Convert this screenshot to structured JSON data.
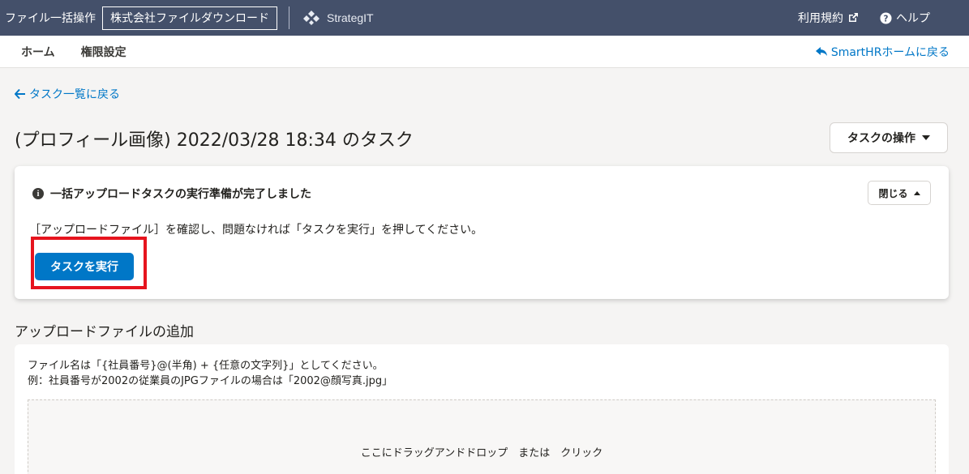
{
  "header": {
    "app_title": "ファイル一括操作",
    "company_name": "株式会社ファイルダウンロード",
    "logo_text": "StrategIT",
    "terms_label": "利用規約",
    "help_label": "ヘルプ"
  },
  "subnav": {
    "items": [
      "ホーム",
      "権限設定"
    ],
    "back_smarthr": "SmartHRホームに戻る"
  },
  "back_to_list": "タスク一覧に戻る",
  "page": {
    "title": "(プロフィール画像) 2022/03/28 18:34 のタスク",
    "task_ops_label": "タスクの操作"
  },
  "notice": {
    "heading": "一括アップロードタスクの実行準備が完了しました",
    "close_label": "閉じる",
    "body": "［アップロードファイル］を確認し、問題なければ「タスクを実行」を押してください。",
    "run_button": "タスクを実行"
  },
  "upload": {
    "section_title": "アップロードファイルの追加",
    "desc_line1": "ファイル名は「{社員番号}@(半角) + {任意の文字列}」としてください。",
    "desc_line2": "例：社員番号が2002の従業員のJPGファイルの場合は「2002@顔写真.jpg」",
    "dropzone_text": "ここにドラッグアンドドロップ　または　クリック"
  },
  "colors": {
    "header_bg": "#44506a",
    "link": "#0077c7",
    "primary_button": "#0077c7",
    "highlight": "#e6141e"
  },
  "icons": [
    "external-link-icon",
    "question-circle-icon",
    "reply-arrow-icon",
    "arrow-left-icon",
    "caret-down-icon",
    "info-icon",
    "caret-up-icon"
  ]
}
